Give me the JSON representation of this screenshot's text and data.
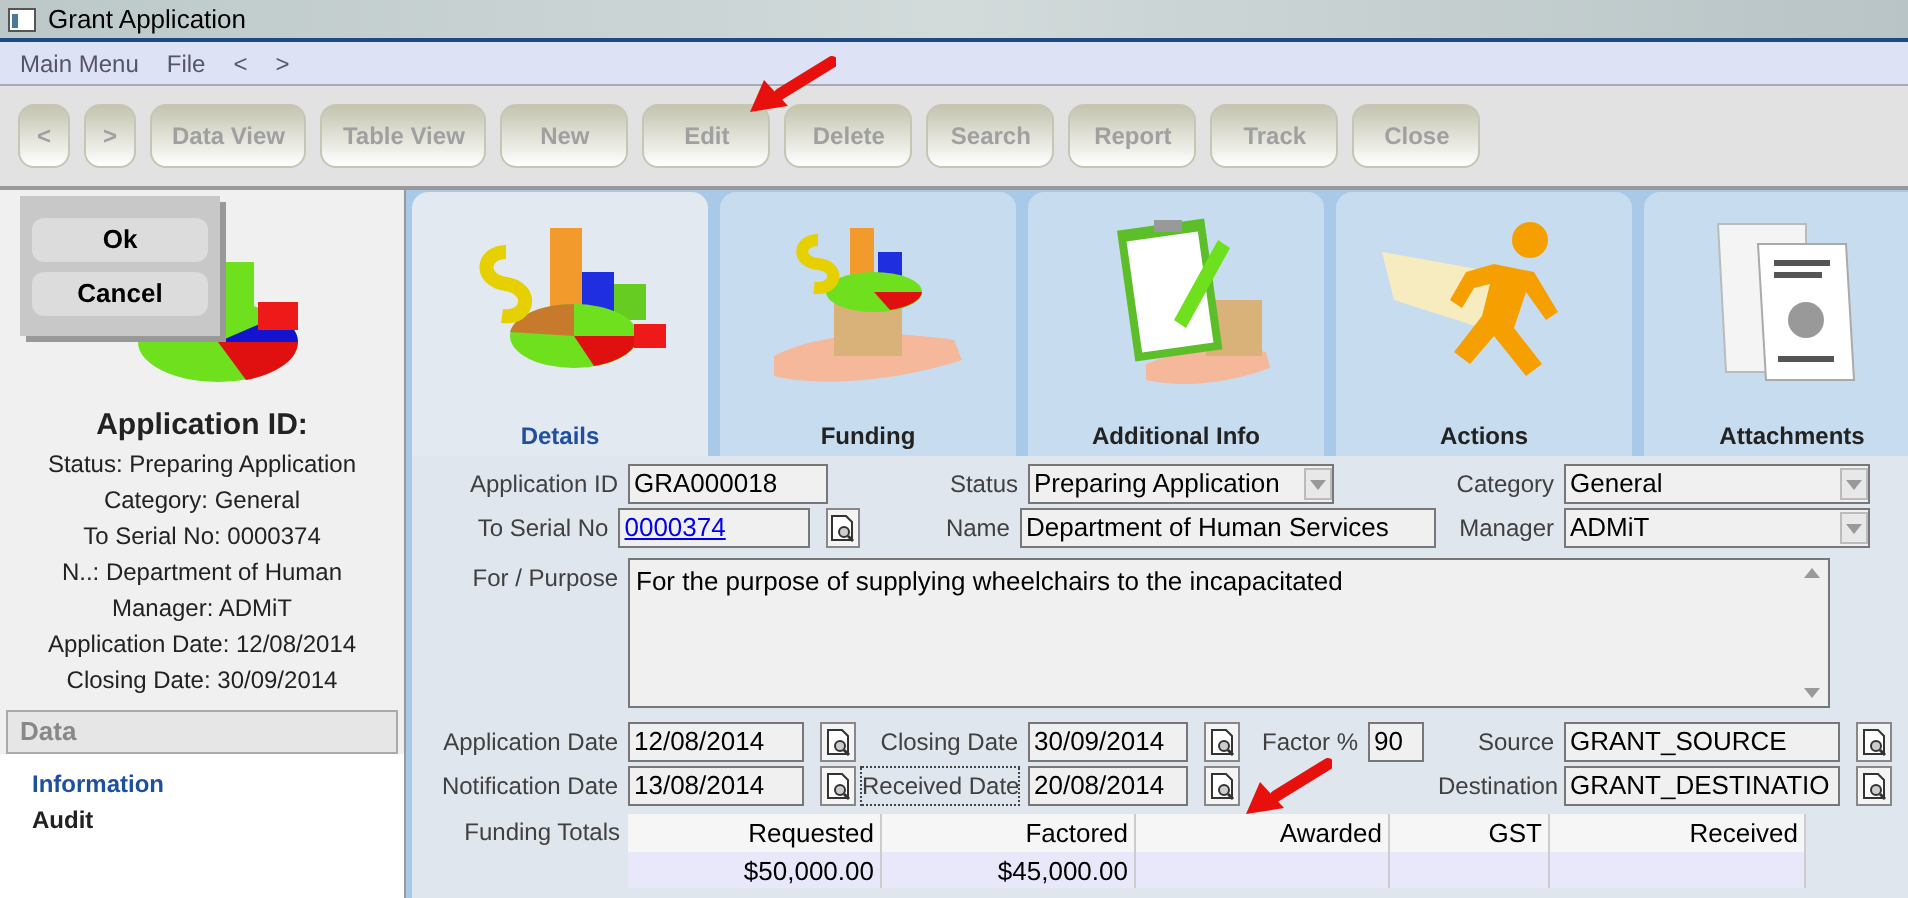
{
  "window": {
    "title": "Grant Application"
  },
  "menu": [
    "Main Menu",
    "File",
    "<",
    ">"
  ],
  "toolbar": [
    {
      "label": "<",
      "disabled": true
    },
    {
      "label": ">",
      "disabled": true
    },
    {
      "label": "Data View",
      "disabled": true
    },
    {
      "label": "Table View",
      "disabled": true
    },
    {
      "label": "New",
      "disabled": true
    },
    {
      "label": "Edit",
      "disabled": true
    },
    {
      "label": "Delete",
      "disabled": true
    },
    {
      "label": "Search",
      "disabled": true
    },
    {
      "label": "Report",
      "disabled": true
    },
    {
      "label": "Track",
      "disabled": true
    },
    {
      "label": "Close",
      "disabled": true
    }
  ],
  "dialog": {
    "buttons": [
      "Ok",
      "Cancel"
    ]
  },
  "summary": {
    "title": "Application ID:",
    "lines": [
      "Status: Preparing Application",
      "Category: General",
      "To Serial No: 0000374",
      "N..: Department of Human",
      "Manager: ADMiT",
      "Application Date: 12/08/2014",
      "Closing Date: 30/09/2014"
    ]
  },
  "nav": {
    "header": "Data",
    "items": [
      {
        "label": "Information",
        "selected": true
      },
      {
        "label": "Audit",
        "selected": false
      }
    ]
  },
  "tabs": [
    {
      "label": "Details",
      "selected": true
    },
    {
      "label": "Funding",
      "selected": false
    },
    {
      "label": "Additional Info",
      "selected": false
    },
    {
      "label": "Actions",
      "selected": false
    },
    {
      "label": "Attachments",
      "selected": false
    }
  ],
  "form": {
    "rows": [
      [
        {
          "label": "Application ID",
          "value": "GRA000018",
          "kind": "text",
          "lookup": false,
          "focused": false
        },
        {
          "label": "Status",
          "value": "Preparing Application",
          "kind": "dropdown",
          "lookup": false,
          "focused": false
        },
        {
          "label": "Category",
          "value": "General",
          "kind": "dropdown",
          "lookup": false,
          "focused": false
        }
      ],
      [
        {
          "label": "To Serial No",
          "value": "0000374",
          "kind": "link",
          "lookup": true,
          "focused": false
        },
        {
          "label": "Name",
          "value": "Department of Human Services",
          "kind": "text",
          "lookup": false,
          "focused": false
        },
        {
          "label": "Manager",
          "value": "ADMiT",
          "kind": "dropdown",
          "lookup": false,
          "focused": false
        }
      ],
      [
        {
          "label": "For / Purpose",
          "value": "For the purpose of supplying wheelchairs to the incapacitated",
          "kind": "textarea",
          "lookup": false,
          "focused": false
        }
      ],
      [
        {
          "label": "Application Date",
          "value": "12/08/2014",
          "kind": "text",
          "lookup": true,
          "focused": false
        },
        {
          "label": "Closing Date",
          "value": "30/09/2014",
          "kind": "text",
          "lookup": true,
          "focused": false
        },
        {
          "label": "Factor %",
          "value": "90",
          "kind": "text",
          "lookup": false,
          "focused": false
        },
        {
          "label": "Source",
          "value": "GRANT_SOURCE",
          "kind": "text",
          "lookup": true,
          "focused": false
        }
      ],
      [
        {
          "label": "Notification Date",
          "value": "13/08/2014",
          "kind": "text",
          "lookup": true,
          "focused": false
        },
        {
          "label": "Received Date",
          "value": "20/08/2014",
          "kind": "text",
          "lookup": true,
          "focused": true
        },
        {
          "label": "Destination",
          "value": "GRANT_DESTINATIO",
          "kind": "text",
          "lookup": true,
          "focused": false
        }
      ]
    ]
  },
  "funding_totals": {
    "label": "Funding Totals",
    "columns": [
      "Requested",
      "Factored",
      "Awarded",
      "GST",
      "Received"
    ],
    "rows": [
      [
        "$50,000.00",
        "$45,000.00"
      ]
    ]
  }
}
